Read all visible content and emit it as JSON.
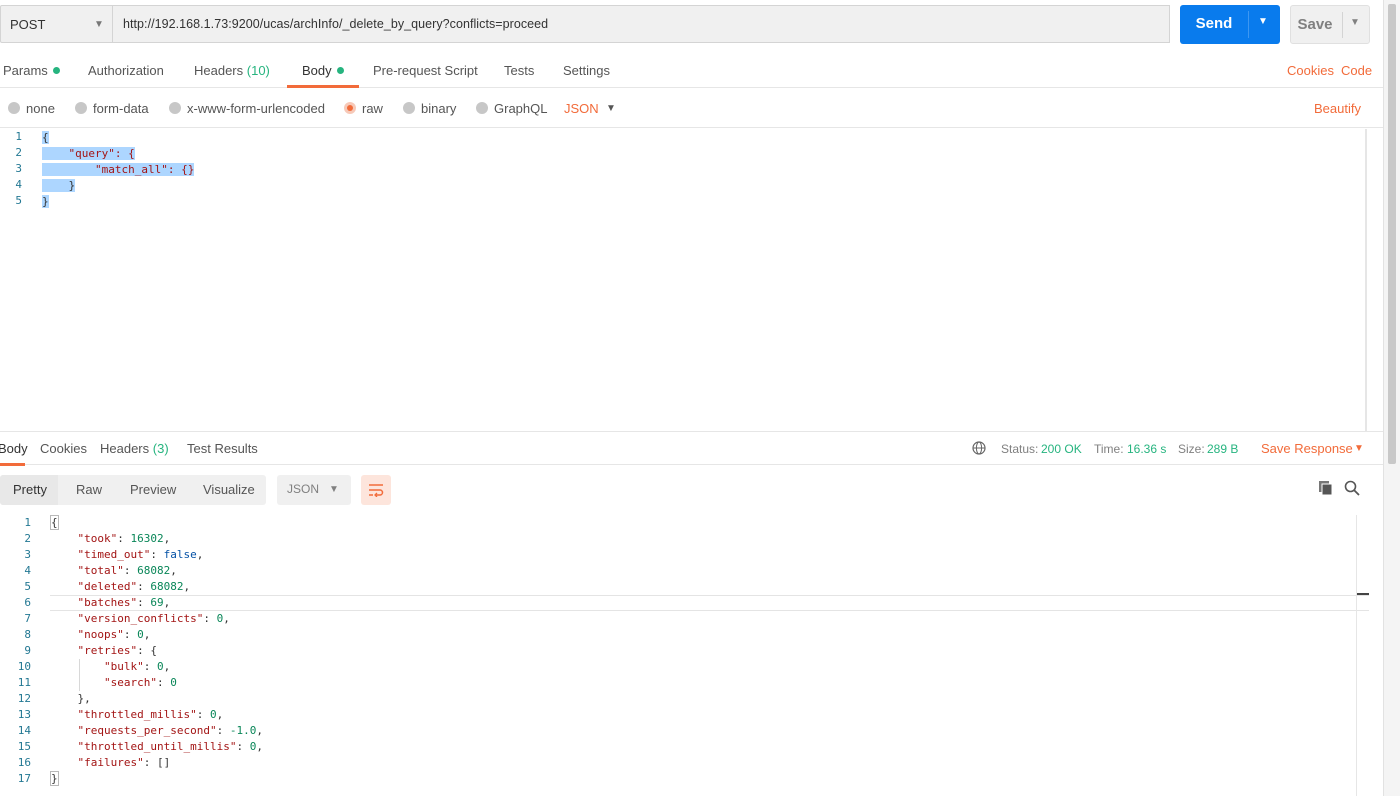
{
  "request": {
    "method": "POST",
    "url": "http://192.168.1.73:9200/ucas/archInfo/_delete_by_query?conflicts=proceed",
    "send_label": "Send",
    "save_label": "Save"
  },
  "request_tabs": {
    "params": "Params",
    "authorization": "Authorization",
    "headers": "Headers",
    "headers_count": "(10)",
    "body": "Body",
    "prerequest": "Pre-request Script",
    "tests": "Tests",
    "settings": "Settings",
    "cookies": "Cookies",
    "code": "Code"
  },
  "body_types": {
    "none": "none",
    "form_data": "form-data",
    "urlencoded": "x-www-form-urlencoded",
    "raw": "raw",
    "binary": "binary",
    "graphql": "GraphQL",
    "language": "JSON",
    "beautify": "Beautify"
  },
  "request_body_lines": [
    {
      "n": "1",
      "text": "{"
    },
    {
      "n": "2",
      "text": "\"query\": {"
    },
    {
      "n": "3",
      "text": "\"match_all\": {}"
    },
    {
      "n": "4",
      "text": "}"
    },
    {
      "n": "5",
      "text": "}"
    }
  ],
  "response_tabs": {
    "body": "Body",
    "cookies": "Cookies",
    "headers": "Headers",
    "headers_count": "(3)",
    "test_results": "Test Results"
  },
  "response_meta": {
    "status_label": "Status:",
    "status": "200 OK",
    "time_label": "Time:",
    "time": "16.36 s",
    "size_label": "Size:",
    "size": "289 B",
    "save_response": "Save Response"
  },
  "response_toolbar": {
    "pretty": "Pretty",
    "raw": "Raw",
    "preview": "Preview",
    "visualize": "Visualize",
    "format": "JSON"
  },
  "response_lines": [
    "1",
    "2",
    "3",
    "4",
    "5",
    "6",
    "7",
    "8",
    "9",
    "10",
    "11",
    "12",
    "13",
    "14",
    "15",
    "16",
    "17"
  ],
  "response_body": {
    "took": "16302",
    "timed_out": "false",
    "total": "68082",
    "deleted": "68082",
    "batches": "69",
    "version_conflicts": "0",
    "noops": "0",
    "bulk": "0",
    "search": "0",
    "throttled_millis": "0",
    "requests_per_second": "-1.0",
    "throttled_until_millis": "0",
    "failures": "[]"
  },
  "colors": {
    "accent": "#f26b3a",
    "send_blue": "#097bed",
    "success_green": "#26b47f",
    "json_key": "#a31515",
    "json_number": "#098658",
    "json_keyword": "#0451a5",
    "selection": "#add6ff"
  },
  "icons": [
    "chevron-down-icon",
    "globe-icon",
    "wrap-lines-icon",
    "copy-icon",
    "search-icon"
  ]
}
